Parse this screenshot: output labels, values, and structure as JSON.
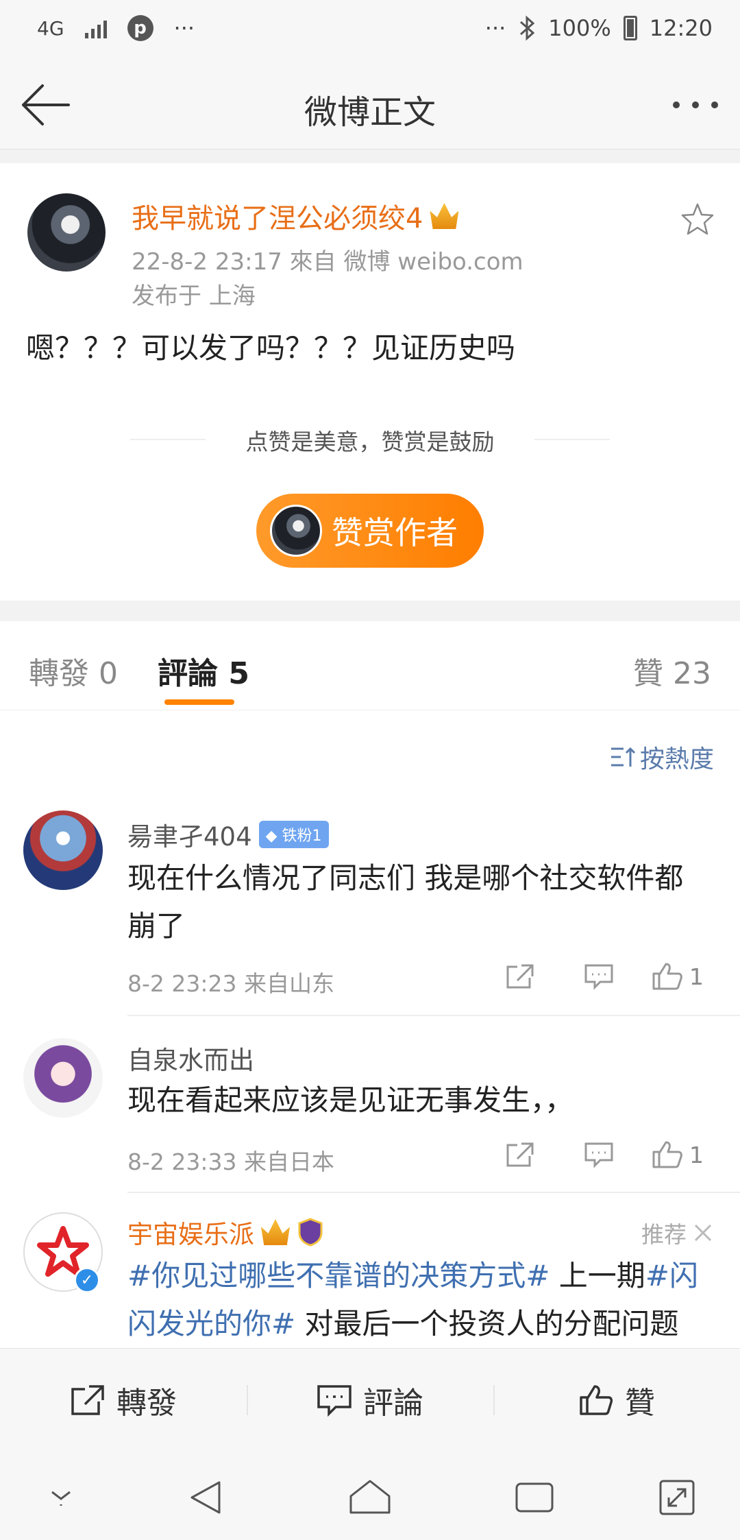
{
  "status_bar": {
    "network": "4G",
    "dots_left": "···",
    "dots_right": "···",
    "battery": "100%",
    "time": "12:20"
  },
  "nav": {
    "title": "微博正文"
  },
  "post": {
    "author": "我早就说了涅公必须绞4",
    "time_source": "22-8-2 23:17   來自 微博 weibo.com",
    "location": "发布于 上海",
    "content": "嗯？？？可以发了吗？？？见证历史吗",
    "reward_hint": "点赞是美意，赞赏是鼓励",
    "reward_button": "赞赏作者"
  },
  "tabs": {
    "repost": "轉發 0",
    "comments": "評論 5",
    "likes": "贊 23"
  },
  "sort_label": "按熱度",
  "comments": [
    {
      "name": "昜聿孑404",
      "badge": "铁粉1",
      "text": "现在什么情况了同志们  我是哪个社交软件都崩了",
      "meta": "8-2 23:23  来自山东",
      "likes": "1"
    },
    {
      "name": "自泉水而出",
      "text": "现在看起来应该是见证无事发生，，",
      "meta": "8-2 23:33  来自日本",
      "likes": "1"
    }
  ],
  "promoted": {
    "name": "宇宙娱乐派",
    "tag": "推荐",
    "hashtag1": "#你见过哪些不靠谱的决策方式#",
    "text1": " 上一期",
    "hashtag2": "#闪闪发光的你#",
    "text2": " 对最后一个投资人的分配问题要很多情况的。双方都同意用猜拳来表的"
  },
  "bottom_bar": {
    "repost": "轉發",
    "comment": "評論",
    "like": "贊"
  },
  "colors": {
    "accent_orange": "#ff8200",
    "username_orange": "#e86e17",
    "link_blue": "#3f6fb0"
  }
}
